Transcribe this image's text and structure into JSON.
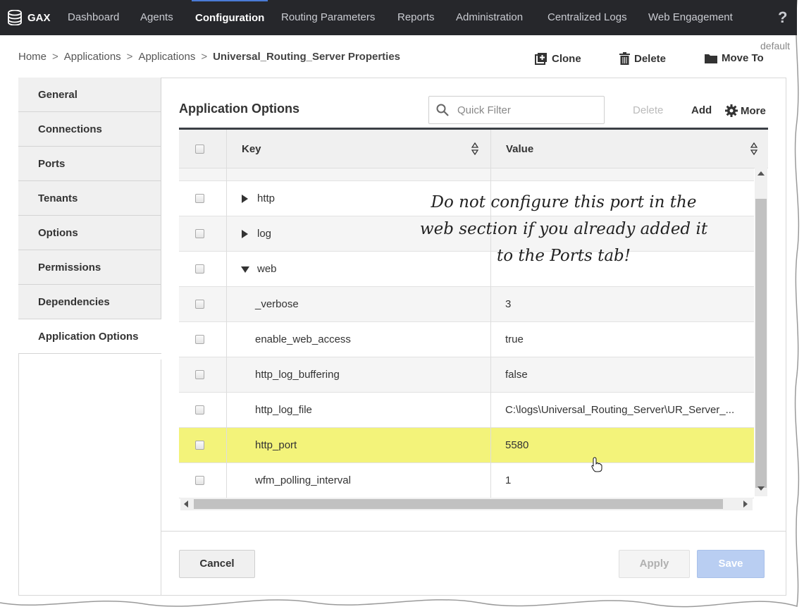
{
  "nav": {
    "brand": "GAX",
    "items": [
      "Dashboard",
      "Agents",
      "Configuration",
      "Routing Parameters",
      "Reports",
      "Administration",
      "Centralized Logs",
      "Web Engagement"
    ],
    "active": "Configuration",
    "help": "?"
  },
  "breadcrumb": {
    "home": "Home",
    "level1": "Applications",
    "level2": "Applications",
    "current": "Universal_Routing_Server Properties",
    "separator": ">"
  },
  "tenant_tag": "default",
  "toolbar": {
    "clone": "Clone",
    "delete": "Delete",
    "move_to": "Move To"
  },
  "sidebar": {
    "items": [
      "General",
      "Connections",
      "Ports",
      "Tenants",
      "Options",
      "Permissions",
      "Dependencies",
      "Application Options"
    ],
    "active": "Application Options"
  },
  "main": {
    "title": "Application Options",
    "filter_placeholder": "Quick Filter",
    "actions": {
      "delete": "Delete",
      "add": "Add",
      "more": "More"
    },
    "columns": {
      "key": "Key",
      "value": "Value"
    },
    "rows": [
      {
        "key": "http",
        "value": "",
        "type": "section",
        "expanded": false
      },
      {
        "key": "log",
        "value": "",
        "type": "section",
        "expanded": false
      },
      {
        "key": "web",
        "value": "",
        "type": "section",
        "expanded": true
      },
      {
        "key": "_verbose",
        "value": "3",
        "type": "option"
      },
      {
        "key": "enable_web_access",
        "value": "true",
        "type": "option"
      },
      {
        "key": "http_log_buffering",
        "value": "false",
        "type": "option"
      },
      {
        "key": "http_log_file",
        "value": "C:\\logs\\Universal_Routing_Server\\UR_Server_...",
        "type": "option"
      },
      {
        "key": "http_port",
        "value": "5580",
        "type": "option",
        "highlighted": true
      },
      {
        "key": "wfm_polling_interval",
        "value": "1",
        "type": "option"
      }
    ],
    "annotation": "Do not configure this port in the web section if you already added it to the Ports tab!"
  },
  "footer": {
    "cancel": "Cancel",
    "apply": "Apply",
    "save": "Save"
  },
  "colors": {
    "nav_bg": "#26272b",
    "highlight": "#f3f37a",
    "save_bg": "#b9cef2",
    "accent": "#4a7bd6"
  }
}
